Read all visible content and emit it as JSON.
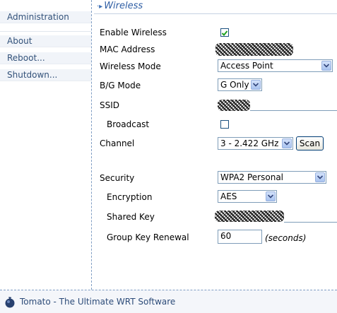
{
  "sidebar": {
    "items": [
      {
        "label": "Administration"
      },
      {
        "label": "About"
      },
      {
        "label": "Reboot..."
      },
      {
        "label": "Shutdown..."
      }
    ]
  },
  "section": {
    "title": "Wireless"
  },
  "form": {
    "enable_wireless": {
      "label": "Enable Wireless",
      "checked": true
    },
    "mac_address": {
      "label": "MAC Address"
    },
    "wireless_mode": {
      "label": "Wireless Mode",
      "value": "Access Point"
    },
    "bg_mode": {
      "label": "B/G Mode",
      "value": "G Only"
    },
    "ssid": {
      "label": "SSID"
    },
    "broadcast": {
      "label": "Broadcast",
      "checked": false
    },
    "channel": {
      "label": "Channel",
      "value": "3 - 2.422 GHz",
      "scan_label": "Scan"
    },
    "security": {
      "label": "Security",
      "value": "WPA2 Personal"
    },
    "encryption": {
      "label": "Encryption",
      "value": "AES"
    },
    "shared_key": {
      "label": "Shared Key"
    },
    "group_key_renewal": {
      "label": "Group Key Renewal",
      "value": "60",
      "unit": "(seconds)"
    }
  },
  "footer": {
    "text": "Tomato - The Ultimate WRT Software"
  },
  "colors": {
    "accent": "#2f5ea4",
    "link": "#33527a",
    "separator": "#7f9dc3"
  }
}
